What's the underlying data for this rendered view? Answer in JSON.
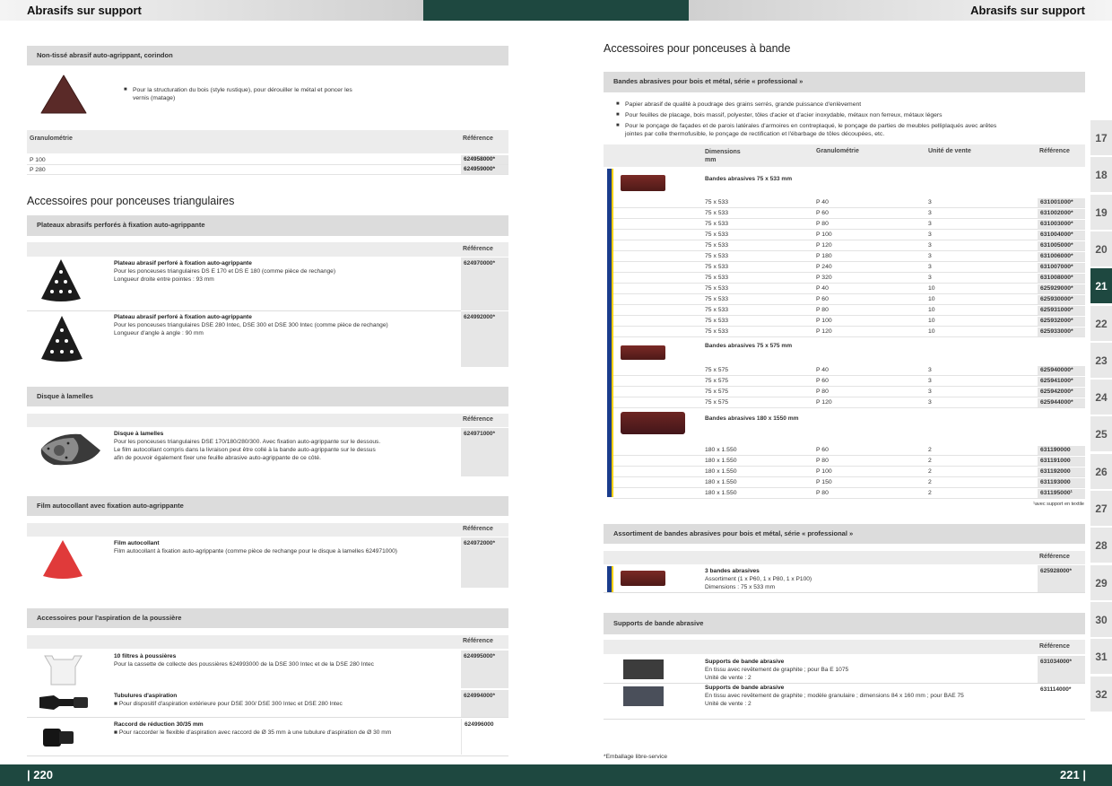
{
  "header": {
    "left_title": "Abrasifs sur support",
    "right_title": "Abrasifs sur support"
  },
  "footer": {
    "left_page": "| 220",
    "right_page": "221 |",
    "note": "*Emballage libre-service"
  },
  "left": {
    "nontisse": {
      "title": "Non-tissé abrasif auto-agrippant, corindon",
      "bullet": "Pour la structuration du bois (style rustique), pour dérouiller le métal et poncer les vernis (matage)",
      "col_gran": "Granulométrie",
      "col_ref": "Référence",
      "rows": [
        {
          "g": "P 100",
          "r": "624958000*"
        },
        {
          "g": "P 280",
          "r": "624959000*"
        }
      ]
    },
    "triangulaires_title": "Accessoires pour ponceuses triangulaires",
    "plateaux": {
      "title": "Plateaux abrasifs perforés à fixation auto-agrippante",
      "col_ref": "Référence",
      "items": [
        {
          "name": "Plateau abrasif perforé à fixation auto-agrippante",
          "l1": "Pour les ponceuses triangulaires DS E 170 et DS E 180 (comme pièce de rechange)",
          "l2": "Longueur droite entre pointes : 93 mm",
          "ref": "624970000*"
        },
        {
          "name": "Plateau abrasif perforé à fixation auto-agrippante",
          "l1": "Pour les ponceuses triangulaires  DSE 280 Intec, DSE 300 et DSE 300 Intec (comme pièce de rechange)",
          "l2": "Longueur d'angle à angle : 90 mm",
          "ref": "624992000*"
        }
      ]
    },
    "disque": {
      "title": "Disque à lamelles",
      "col_ref": "Référence",
      "name": "Disque à lamelles",
      "l1": "Pour les ponceuses triangulaires DSE 170/180/280/300. Avec fixation auto-agrippante sur le dessous.",
      "l2": "Le film autocollant compris dans la livraison peut être collé à la bande auto-agrippante sur le dessus",
      "l3": "afin de pouvoir également fixer une feuille abrasive auto-agrippante de ce côté.",
      "ref": "624971000*"
    },
    "film": {
      "title": "Film autocollant avec fixation auto-agrippante",
      "col_ref": "Référence",
      "name": "Film autocollant",
      "l1": "Film autocollant à fixation auto-agrippante (comme pièce de rechange pour le disque à lamelles 624971000)",
      "ref": "624972000*"
    },
    "aspiration": {
      "title": "Accessoires pour l'aspiration de la poussière",
      "col_ref": "Référence",
      "items": [
        {
          "name": "10 filtres à poussières",
          "l1": "Pour la cassette de collecte des poussières 624993000 de la DSE 300 Intec et de la DSE 280 Intec",
          "ref": "624995000*"
        },
        {
          "name": "Tubulures d'aspiration",
          "l1": "Pour dispositif d'aspiration extérieure pour DSE 300/ DSE 300 Intec et DSE 280 Intec",
          "ref": "624994000*"
        },
        {
          "name": "Raccord de réduction 30/35 mm",
          "l1": "Pour raccorder le flexible d'aspiration avec raccord de Ø 35 mm à une tubulure d'aspiration de Ø 30 mm",
          "ref": "624996000"
        }
      ]
    }
  },
  "right": {
    "bande_title": "Accessoires pour ponceuses à bande",
    "bandes": {
      "title": "Bandes abrasives pour bois et métal, série « professional »",
      "bullets": [
        "Papier abrasif de qualité à poudrage des grains serrés, grande puissance d'enlèvement",
        "Pour feuilles de placage, bois massif, polyester, tôles d'acier et d'acier inoxydable, métaux non ferreux, métaux légers",
        "Pour le ponçage de façades et de parois latérales d'armoires en contreplaqué, le ponçage de parties de meubles pelliplaqués avec arêtes",
        "jointes par colle thermofusible, le ponçage de rectification et l'ébarbage de tôles découpées, etc."
      ],
      "col_dim": "Dimensions",
      "col_dim2": "mm",
      "col_gran": "Granulométrie",
      "col_unit": "Unité de vente",
      "col_ref": "Référence",
      "g1": "Bandes abrasives 75 x 533 mm",
      "g1rows": [
        [
          "75 x 533",
          "P 40",
          "3",
          "631001000*"
        ],
        [
          "75 x 533",
          "P 60",
          "3",
          "631002000*"
        ],
        [
          "75 x 533",
          "P 80",
          "3",
          "631003000*"
        ],
        [
          "75 x 533",
          "P 100",
          "3",
          "631004000*"
        ],
        [
          "75 x 533",
          "P 120",
          "3",
          "631005000*"
        ],
        [
          "75 x 533",
          "P 180",
          "3",
          "631006000*"
        ],
        [
          "75 x 533",
          "P 240",
          "3",
          "631007000*"
        ],
        [
          "75 x 533",
          "P 320",
          "3",
          "631008000*"
        ],
        [
          "75 x 533",
          "P 40",
          "10",
          "625929000*"
        ],
        [
          "75 x 533",
          "P 60",
          "10",
          "625930000*"
        ],
        [
          "75 x 533",
          "P 80",
          "10",
          "625931000*"
        ],
        [
          "75 x 533",
          "P 100",
          "10",
          "625932000*"
        ],
        [
          "75 x 533",
          "P 120",
          "10",
          "625933000*"
        ]
      ],
      "g2": "Bandes abrasives 75 x 575 mm",
      "g2rows": [
        [
          "75 x 575",
          "P 40",
          "3",
          "625940000*"
        ],
        [
          "75 x 575",
          "P 60",
          "3",
          "625941000*"
        ],
        [
          "75 x 575",
          "P 80",
          "3",
          "625942000*"
        ],
        [
          "75 x 575",
          "P 120",
          "3",
          "625944000*"
        ]
      ],
      "g3": "Bandes abrasives 180 x 1550 mm",
      "g3rows": [
        [
          "180 x 1.550",
          "P 60",
          "2",
          "631190000"
        ],
        [
          "180 x 1.550",
          "P 80",
          "2",
          "631191000"
        ],
        [
          "180 x 1.550",
          "P 100",
          "2",
          "631192000"
        ],
        [
          "180 x 1.550",
          "P 150",
          "2",
          "631193000"
        ],
        [
          "180 x 1.550",
          "P 80",
          "2",
          "631195000¹"
        ]
      ],
      "footnote": "¹avec support en textile"
    },
    "assortiment": {
      "title": "Assortiment de bandes abrasives pour bois et métal, série « professional »",
      "col_ref": "Référence",
      "name": "3 bandes abrasives",
      "l1": "Assortiment (1 x P60, 1 x P80, 1 x P100)",
      "l2": "Dimensions : 75 x 533 mm",
      "ref": "625928000*"
    },
    "supports": {
      "title": "Supports de bande abrasive",
      "col_ref": "Référence",
      "items": [
        {
          "name": "Supports de bande abrasive",
          "l1": "En tissu avec revêtement de graphite ; pour Ba E 1075",
          "l2": "Unité de vente : 2",
          "ref": "631034000*"
        },
        {
          "name": "Supports de bande abrasive",
          "l1": "En tissu avec revêtement de graphite ; modèle granulaire ; dimensions 84 x 160 mm ; pour BAE 75",
          "l2": "Unité de vente : 2",
          "ref": "631114000*"
        }
      ]
    }
  },
  "side_tabs": [
    "17",
    "18",
    "19",
    "20",
    "21",
    "22",
    "23",
    "24",
    "25",
    "26",
    "27",
    "28",
    "29",
    "30",
    "31",
    "32"
  ],
  "active_tab": "21",
  "colors": {
    "dark_green": "#1e4840",
    "section_grey": "#dcdcdc",
    "strip_blue": "#1a3c8c",
    "strip_yellow": "#f5d000"
  }
}
